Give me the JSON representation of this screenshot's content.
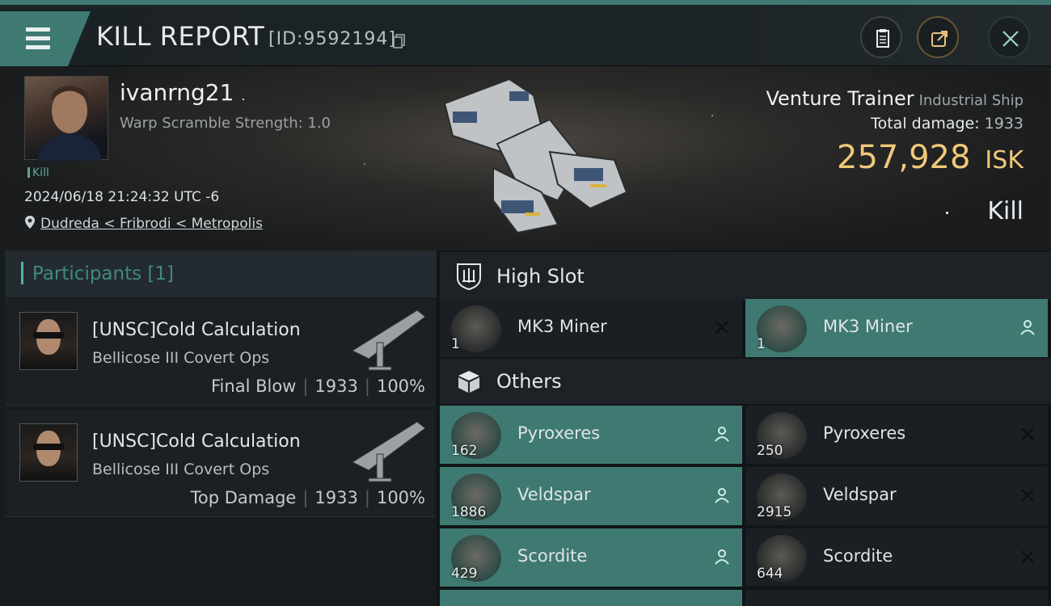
{
  "header": {
    "title": "KILL REPORT",
    "report_id": "[ID:9592194]",
    "icons": [
      "menu-icon",
      "copy-icon",
      "document-icon",
      "share-icon",
      "close-icon"
    ]
  },
  "victim": {
    "name": "ivanrng21",
    "warp_scramble": "Warp Scramble Strength: 1.0",
    "tag": "Kill",
    "datetime": "2024/06/18 21:24:32 UTC -6",
    "location": "Dudreda < Fribrodi < Metropolis"
  },
  "ship": {
    "name": "Venture Trainer",
    "class": "Industrial Ship",
    "total_damage_label": "Total damage:",
    "total_damage": "1933",
    "isk_value": "257,928",
    "isk_unit": "ISK",
    "result": "Kill"
  },
  "participants": {
    "header": "Participants [1]",
    "items": [
      {
        "corp_name": "[UNSC]Cold Calculation",
        "ship": "Bellicose III Covert Ops",
        "role": "Final Blow",
        "damage": "1933",
        "percent": "100%"
      },
      {
        "corp_name": "[UNSC]Cold Calculation",
        "ship": "Bellicose III Covert Ops",
        "role": "Top Damage",
        "damage": "1933",
        "percent": "100%"
      }
    ]
  },
  "high_slot": {
    "title": "High Slot",
    "items": [
      {
        "name": "MK3 Miner",
        "qty": "1",
        "status": "destroyed"
      },
      {
        "name": "MK3 Miner",
        "qty": "1",
        "status": "dropped"
      }
    ]
  },
  "others": {
    "title": "Others",
    "items": [
      {
        "name": "Pyroxeres",
        "qty": "162",
        "status": "dropped"
      },
      {
        "name": "Pyroxeres",
        "qty": "250",
        "status": "destroyed"
      },
      {
        "name": "Veldspar",
        "qty": "1886",
        "status": "dropped"
      },
      {
        "name": "Veldspar",
        "qty": "2915",
        "status": "destroyed"
      },
      {
        "name": "Scordite",
        "qty": "429",
        "status": "dropped"
      },
      {
        "name": "Scordite",
        "qty": "644",
        "status": "destroyed"
      }
    ]
  },
  "colors": {
    "accent": "#3f7a72",
    "isk": "#efc87a",
    "teal_text": "#3f8a80"
  }
}
